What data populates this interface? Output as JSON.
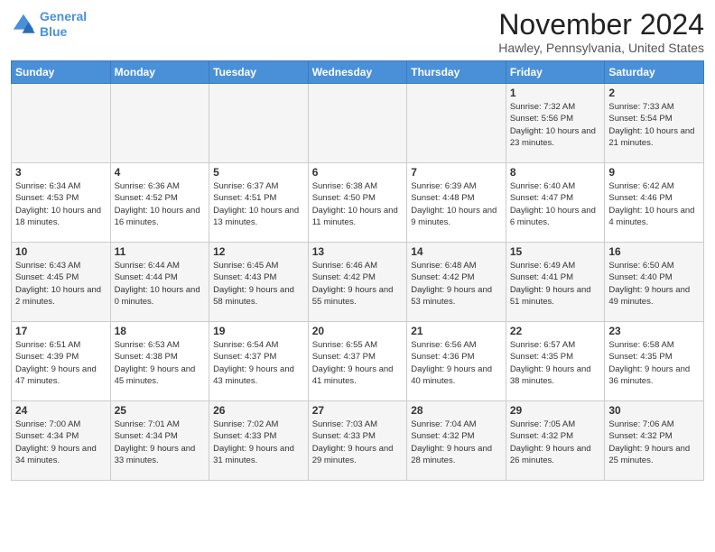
{
  "logo": {
    "line1": "General",
    "line2": "Blue"
  },
  "title": "November 2024",
  "location": "Hawley, Pennsylvania, United States",
  "days_of_week": [
    "Sunday",
    "Monday",
    "Tuesday",
    "Wednesday",
    "Thursday",
    "Friday",
    "Saturday"
  ],
  "weeks": [
    [
      {
        "day": "",
        "info": ""
      },
      {
        "day": "",
        "info": ""
      },
      {
        "day": "",
        "info": ""
      },
      {
        "day": "",
        "info": ""
      },
      {
        "day": "",
        "info": ""
      },
      {
        "day": "1",
        "info": "Sunrise: 7:32 AM\nSunset: 5:56 PM\nDaylight: 10 hours and 23 minutes."
      },
      {
        "day": "2",
        "info": "Sunrise: 7:33 AM\nSunset: 5:54 PM\nDaylight: 10 hours and 21 minutes."
      }
    ],
    [
      {
        "day": "3",
        "info": "Sunrise: 6:34 AM\nSunset: 4:53 PM\nDaylight: 10 hours and 18 minutes."
      },
      {
        "day": "4",
        "info": "Sunrise: 6:36 AM\nSunset: 4:52 PM\nDaylight: 10 hours and 16 minutes."
      },
      {
        "day": "5",
        "info": "Sunrise: 6:37 AM\nSunset: 4:51 PM\nDaylight: 10 hours and 13 minutes."
      },
      {
        "day": "6",
        "info": "Sunrise: 6:38 AM\nSunset: 4:50 PM\nDaylight: 10 hours and 11 minutes."
      },
      {
        "day": "7",
        "info": "Sunrise: 6:39 AM\nSunset: 4:48 PM\nDaylight: 10 hours and 9 minutes."
      },
      {
        "day": "8",
        "info": "Sunrise: 6:40 AM\nSunset: 4:47 PM\nDaylight: 10 hours and 6 minutes."
      },
      {
        "day": "9",
        "info": "Sunrise: 6:42 AM\nSunset: 4:46 PM\nDaylight: 10 hours and 4 minutes."
      }
    ],
    [
      {
        "day": "10",
        "info": "Sunrise: 6:43 AM\nSunset: 4:45 PM\nDaylight: 10 hours and 2 minutes."
      },
      {
        "day": "11",
        "info": "Sunrise: 6:44 AM\nSunset: 4:44 PM\nDaylight: 10 hours and 0 minutes."
      },
      {
        "day": "12",
        "info": "Sunrise: 6:45 AM\nSunset: 4:43 PM\nDaylight: 9 hours and 58 minutes."
      },
      {
        "day": "13",
        "info": "Sunrise: 6:46 AM\nSunset: 4:42 PM\nDaylight: 9 hours and 55 minutes."
      },
      {
        "day": "14",
        "info": "Sunrise: 6:48 AM\nSunset: 4:42 PM\nDaylight: 9 hours and 53 minutes."
      },
      {
        "day": "15",
        "info": "Sunrise: 6:49 AM\nSunset: 4:41 PM\nDaylight: 9 hours and 51 minutes."
      },
      {
        "day": "16",
        "info": "Sunrise: 6:50 AM\nSunset: 4:40 PM\nDaylight: 9 hours and 49 minutes."
      }
    ],
    [
      {
        "day": "17",
        "info": "Sunrise: 6:51 AM\nSunset: 4:39 PM\nDaylight: 9 hours and 47 minutes."
      },
      {
        "day": "18",
        "info": "Sunrise: 6:53 AM\nSunset: 4:38 PM\nDaylight: 9 hours and 45 minutes."
      },
      {
        "day": "19",
        "info": "Sunrise: 6:54 AM\nSunset: 4:37 PM\nDaylight: 9 hours and 43 minutes."
      },
      {
        "day": "20",
        "info": "Sunrise: 6:55 AM\nSunset: 4:37 PM\nDaylight: 9 hours and 41 minutes."
      },
      {
        "day": "21",
        "info": "Sunrise: 6:56 AM\nSunset: 4:36 PM\nDaylight: 9 hours and 40 minutes."
      },
      {
        "day": "22",
        "info": "Sunrise: 6:57 AM\nSunset: 4:35 PM\nDaylight: 9 hours and 38 minutes."
      },
      {
        "day": "23",
        "info": "Sunrise: 6:58 AM\nSunset: 4:35 PM\nDaylight: 9 hours and 36 minutes."
      }
    ],
    [
      {
        "day": "24",
        "info": "Sunrise: 7:00 AM\nSunset: 4:34 PM\nDaylight: 9 hours and 34 minutes."
      },
      {
        "day": "25",
        "info": "Sunrise: 7:01 AM\nSunset: 4:34 PM\nDaylight: 9 hours and 33 minutes."
      },
      {
        "day": "26",
        "info": "Sunrise: 7:02 AM\nSunset: 4:33 PM\nDaylight: 9 hours and 31 minutes."
      },
      {
        "day": "27",
        "info": "Sunrise: 7:03 AM\nSunset: 4:33 PM\nDaylight: 9 hours and 29 minutes."
      },
      {
        "day": "28",
        "info": "Sunrise: 7:04 AM\nSunset: 4:32 PM\nDaylight: 9 hours and 28 minutes."
      },
      {
        "day": "29",
        "info": "Sunrise: 7:05 AM\nSunset: 4:32 PM\nDaylight: 9 hours and 26 minutes."
      },
      {
        "day": "30",
        "info": "Sunrise: 7:06 AM\nSunset: 4:32 PM\nDaylight: 9 hours and 25 minutes."
      }
    ]
  ]
}
